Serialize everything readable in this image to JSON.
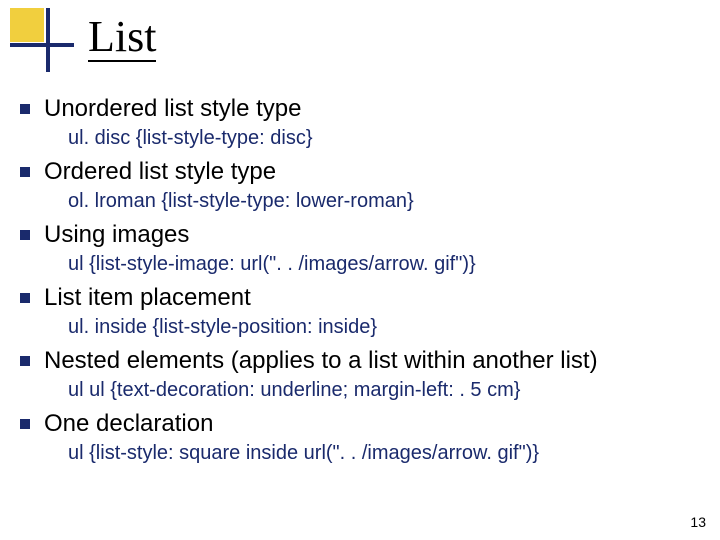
{
  "title": "List",
  "page_number": "13",
  "items": [
    {
      "heading": "Unordered list style type",
      "code": "ul. disc {list-style-type: disc}"
    },
    {
      "heading": "Ordered list style type",
      "code": "ol. lroman {list-style-type: lower-roman}"
    },
    {
      "heading": "Using images",
      "code": "ul {list-style-image: url(\". . /images/arrow. gif\")}"
    },
    {
      "heading": "List item placement",
      "code": "ul. inside {list-style-position: inside}"
    },
    {
      "heading": "Nested elements (applies to a list within another list)",
      "code": "ul ul {text-decoration: underline; margin-left: . 5 cm}"
    },
    {
      "heading": "One declaration",
      "code": "ul {list-style: square inside url(\". . /images/arrow. gif\")}"
    }
  ]
}
